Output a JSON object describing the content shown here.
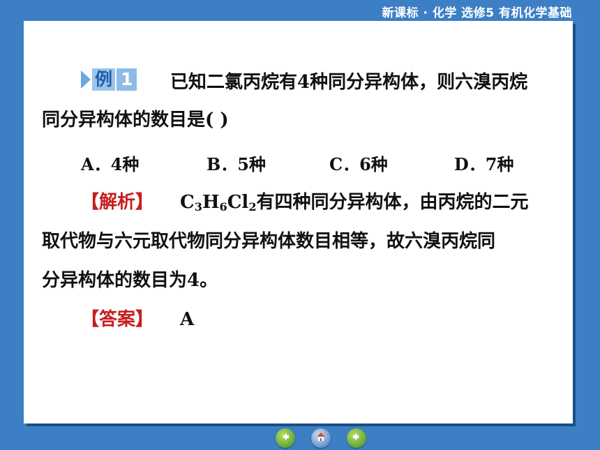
{
  "header": {
    "title": "新课标 · 化学  选修5  有机化学基础"
  },
  "example": {
    "label": "例",
    "number": "1",
    "question_line1": "已知二氯丙烷有4种同分异构体，则六溴丙烷",
    "question_line2": "同分异构体的数目是(        )"
  },
  "options": [
    {
      "label": "A．4种"
    },
    {
      "label": "B．5种"
    },
    {
      "label": "C．6种"
    },
    {
      "label": "D．7种"
    }
  ],
  "analysis": {
    "tag": "【解析】",
    "formula_c": "C",
    "formula_c_sub": "3",
    "formula_h": "H",
    "formula_h_sub": "6",
    "formula_cl": "Cl",
    "formula_cl_sub": "2",
    "line1_rest": "有四种同分异构体，由丙烷的二元",
    "line2": "取代物与六元取代物同分异构体数目相等，故六溴丙烷同",
    "line3": "分异构体的数目为4。"
  },
  "answer": {
    "tag": "【答案】",
    "value": "A"
  },
  "nav": {
    "prev_icon": "back-arrow-icon",
    "home_icon": "home-icon",
    "next_icon": "forward-arrow-icon"
  },
  "colors": {
    "background": "#3d7fc4",
    "accent_red": "#c81e1e",
    "badge": "#9cc4ec"
  }
}
